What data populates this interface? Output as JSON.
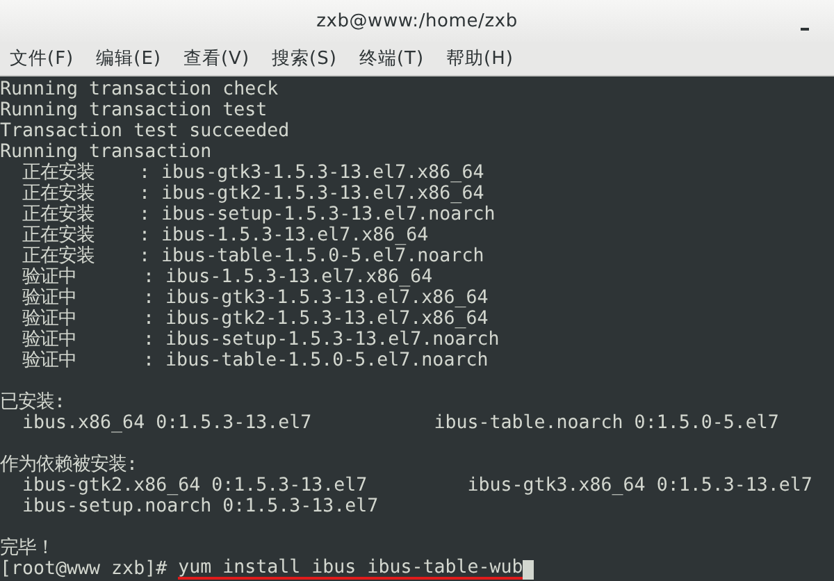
{
  "window": {
    "title": "zxb@www:/home/zxb"
  },
  "menu": [
    "文件(F)",
    "编辑(E)",
    "查看(V)",
    "搜索(S)",
    "终端(T)",
    "帮助(H)"
  ],
  "terminal": {
    "blocks": [
      [
        "Running transaction check",
        "Running transaction test",
        "Transaction test succeeded",
        "Running transaction",
        "  正在安装    : ibus-gtk3-1.5.3-13.el7.x86_64",
        "  正在安装    : ibus-gtk2-1.5.3-13.el7.x86_64",
        "  正在安装    : ibus-setup-1.5.3-13.el7.noarch",
        "  正在安装    : ibus-1.5.3-13.el7.x86_64",
        "  正在安装    : ibus-table-1.5.0-5.el7.noarch",
        "  验证中      : ibus-1.5.3-13.el7.x86_64",
        "  验证中      : ibus-gtk3-1.5.3-13.el7.x86_64",
        "  验证中      : ibus-gtk2-1.5.3-13.el7.x86_64",
        "  验证中      : ibus-setup-1.5.3-13.el7.noarch",
        "  验证中      : ibus-table-1.5.0-5.el7.noarch"
      ],
      [
        "已安装:",
        "  ibus.x86_64 0:1.5.3-13.el7           ibus-table.noarch 0:1.5.0-5.el7"
      ],
      [
        "作为依赖被安装:",
        "  ibus-gtk2.x86_64 0:1.5.3-13.el7         ibus-gtk3.x86_64 0:1.5.3-13.el7",
        "  ibus-setup.noarch 0:1.5.3-13.el7"
      ],
      [
        "完毕！"
      ]
    ],
    "prompt": "[root@www zxb]#",
    "command": "yum install ibus ibus-table-wub"
  }
}
